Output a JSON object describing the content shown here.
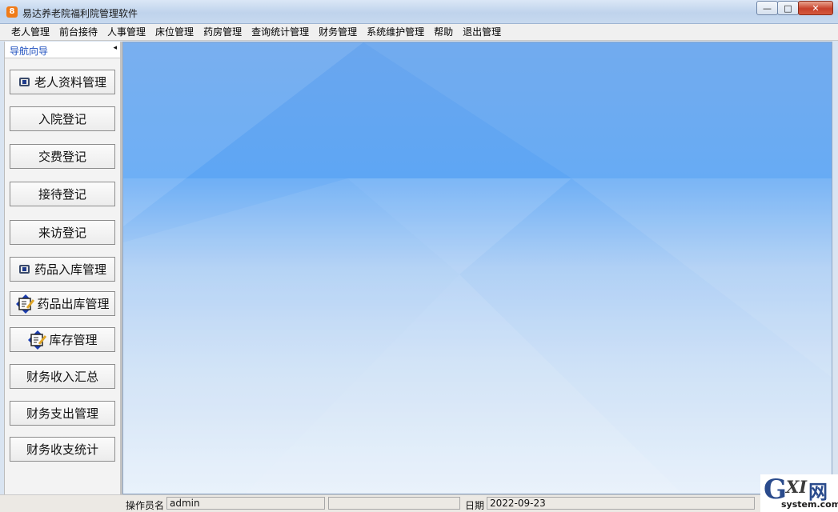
{
  "window": {
    "title": "易达养老院福利院管理软件",
    "app_icon_letter": "8",
    "controls": {
      "minimize": "—",
      "maximize": "□",
      "close": "✕"
    }
  },
  "menu": [
    "老人管理",
    "前台接待",
    "人事管理",
    "床位管理",
    "药房管理",
    "查询统计管理",
    "财务管理",
    "系统维护管理",
    "帮助",
    "退出管理"
  ],
  "nav": {
    "title": "导航向导",
    "collapse_glyph": "◂",
    "buttons": [
      {
        "label": "老人资料管理",
        "icon": "card-icon"
      },
      {
        "label": "入院登记",
        "icon": ""
      },
      {
        "label": "交费登记",
        "icon": ""
      },
      {
        "label": "接待登记",
        "icon": ""
      },
      {
        "label": "来访登记",
        "icon": ""
      },
      {
        "label": "药品入库管理",
        "icon": "card-icon"
      },
      {
        "label": "药品出库管理",
        "icon": "edit-arrows-icon"
      },
      {
        "label": "库存管理",
        "icon": "edit-arrows-icon"
      },
      {
        "label": "财务收入汇总",
        "icon": ""
      },
      {
        "label": "财务支出管理",
        "icon": ""
      },
      {
        "label": "财务收支统计",
        "icon": ""
      }
    ]
  },
  "status": {
    "operator_label": "操作员名",
    "operator_value": "admin",
    "date_label": "日期",
    "date_value": "2022-09-23"
  },
  "watermark": {
    "g": "G",
    "xi": "XI",
    "wang": "网",
    "site": "system.com"
  },
  "colors": {
    "accent": "#1e4fbf",
    "main_top": "#5ea6f4",
    "main_bottom": "#e6f0fb"
  }
}
